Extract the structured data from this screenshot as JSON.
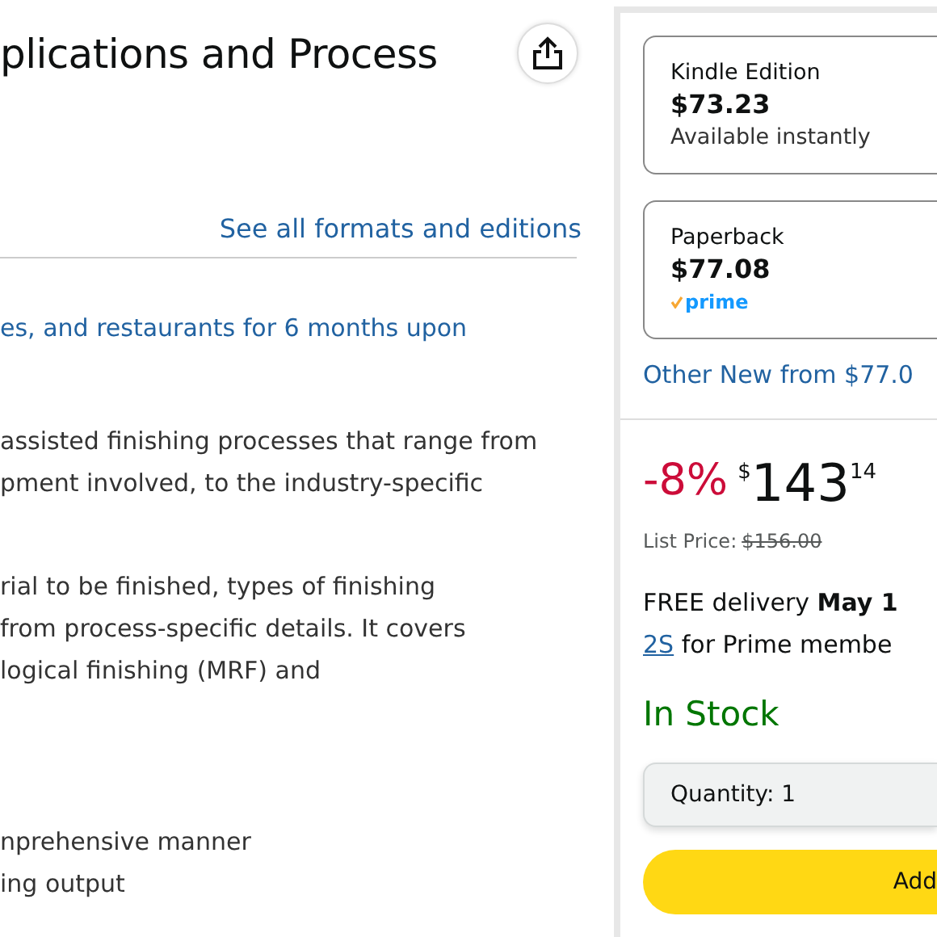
{
  "product": {
    "title": "plications and Process",
    "formats_link": "See all formats and editions",
    "offer_text": "es, and restaurants for 6 months upon",
    "paragraphs": [
      [
        "assisted finishing processes that range from",
        "pment involved, to the industry-specific"
      ],
      [
        "rial to be finished, types of finishing",
        "from process-specific details. It covers",
        "logical finishing (MRF) and"
      ],
      [
        "nprehensive manner",
        "ing output"
      ]
    ]
  },
  "formats": [
    {
      "name": "Kindle Edition",
      "price": "$73.23",
      "note": "Available instantly",
      "kind": "text"
    },
    {
      "name": "Paperback",
      "price": "$77.08",
      "note": "prime",
      "kind": "prime"
    }
  ],
  "other_new": "Other New from $77.0",
  "buy_box": {
    "discount": "-8%",
    "currency": "$",
    "price_whole": "143",
    "price_fraction": "14",
    "list_price_label": "List Price:",
    "list_price": "$156.00",
    "delivery": "FREE delivery **May 1**",
    "delivery_link": "2S",
    "delivery_rest": "for Prime membe",
    "stock": "In Stock",
    "quantity_label": "Quantity:",
    "quantity": "1",
    "add_button": "Add"
  }
}
